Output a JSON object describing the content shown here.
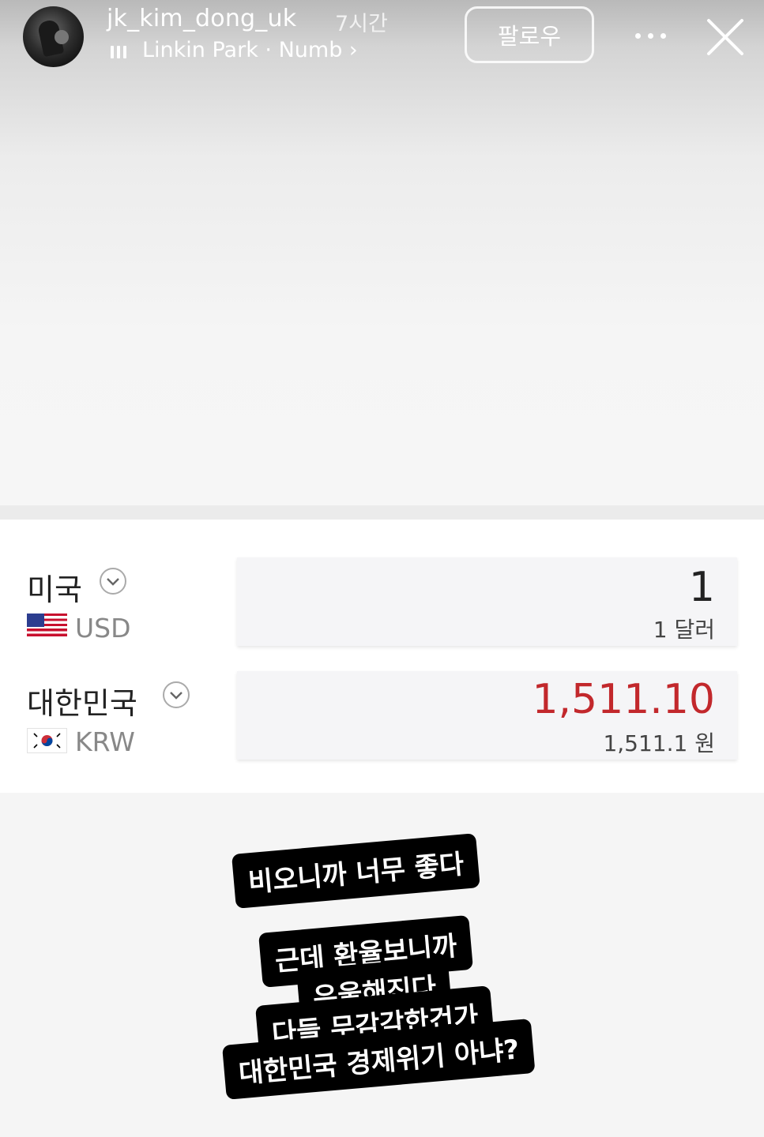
{
  "header": {
    "username": "jk_kim_dong_uk",
    "time_ago": "7시간",
    "music": "Linkin Park · Numb ›",
    "follow_label": "팔로우"
  },
  "converter": {
    "from": {
      "country": "미국",
      "code": "USD",
      "amount": "1",
      "amount_words": "1 달러"
    },
    "to": {
      "country": "대한민국",
      "code": "KRW",
      "amount": "1,511.10",
      "amount_words": "1,511.1 원"
    },
    "accent_color": "#c2282c"
  },
  "captions": [
    "비오니까 너무 좋다",
    "근데 환율보니까",
    "우울해진다",
    "다들 무감각한건가",
    "대한민국 경제위기 아냐?"
  ]
}
